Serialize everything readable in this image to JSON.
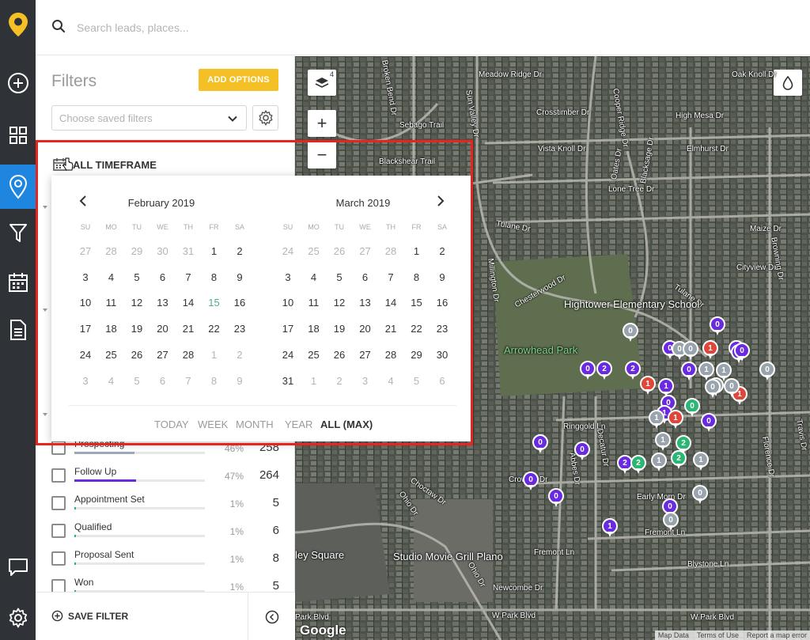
{
  "search": {
    "placeholder": "Search leads, places..."
  },
  "rail": {
    "items": [
      {
        "icon": "app-logo-icon"
      },
      {
        "icon": "plus-circle-icon"
      },
      {
        "icon": "grid-icon"
      },
      {
        "icon": "map-pin-icon",
        "active": true
      },
      {
        "icon": "filter-icon"
      },
      {
        "icon": "calendar-icon"
      },
      {
        "icon": "document-icon"
      },
      {
        "icon": "chat-icon"
      },
      {
        "icon": "settings-icon"
      }
    ],
    "colors": {
      "bg": "#2f3236",
      "active": "#1f86e0",
      "logo": "#f4c025"
    }
  },
  "filters": {
    "title": "Filters",
    "add_options": "ADD OPTIONS",
    "saved_filters_placeholder": "Choose saved filters",
    "timeframe_label": "ALL TIMEFRAME",
    "save_filter": "SAVE FILTER"
  },
  "statuses": [
    {
      "name": "Prospecting",
      "percent": "46%",
      "count": "258",
      "fill": 0.46,
      "color": "#9aa9b8"
    },
    {
      "name": "Follow Up",
      "percent": "47%",
      "count": "264",
      "fill": 0.47,
      "color": "#6a2be0"
    },
    {
      "name": "Appointment Set",
      "percent": "1%",
      "count": "5",
      "fill": 0.01,
      "color": "#2bb673"
    },
    {
      "name": "Qualified",
      "percent": "1%",
      "count": "6",
      "fill": 0.01,
      "color": "#2bb673"
    },
    {
      "name": "Proposal Sent",
      "percent": "1%",
      "count": "8",
      "fill": 0.01,
      "color": "#2bb673"
    },
    {
      "name": "Won",
      "percent": "1%",
      "count": "5",
      "fill": 0.01,
      "color": "#2bb673"
    }
  ],
  "datepicker": {
    "left_month": "February 2019",
    "right_month": "March 2019",
    "weekdays": [
      "SU",
      "MO",
      "TU",
      "WE",
      "TH",
      "FR",
      "SA"
    ],
    "feb_weeks": [
      [
        "27",
        "28",
        "29",
        "30",
        "31",
        "1",
        "2"
      ],
      [
        "3",
        "4",
        "5",
        "6",
        "7",
        "8",
        "9"
      ],
      [
        "10",
        "11",
        "12",
        "13",
        "14",
        "15",
        "16"
      ],
      [
        "17",
        "18",
        "19",
        "20",
        "21",
        "22",
        "23"
      ],
      [
        "24",
        "25",
        "26",
        "27",
        "28",
        "1",
        "2"
      ],
      [
        "3",
        "4",
        "5",
        "6",
        "7",
        "8",
        "9"
      ]
    ],
    "mar_weeks": [
      [
        "24",
        "25",
        "26",
        "27",
        "28",
        "1",
        "2"
      ],
      [
        "3",
        "4",
        "5",
        "6",
        "7",
        "8",
        "9"
      ],
      [
        "10",
        "11",
        "12",
        "13",
        "14",
        "15",
        "16"
      ],
      [
        "17",
        "18",
        "19",
        "20",
        "21",
        "22",
        "23"
      ],
      [
        "24",
        "25",
        "26",
        "27",
        "28",
        "29",
        "30"
      ],
      [
        "31",
        "1",
        "2",
        "3",
        "4",
        "5",
        "6"
      ]
    ],
    "ranges": [
      "TODAY",
      "WEEK",
      "MONTH",
      "YEAR",
      "ALL (MAX)"
    ],
    "active_range": "ALL (MAX)",
    "today_color": "#4caf8f"
  },
  "map": {
    "layers_badge": "4",
    "zoom_in": "+",
    "zoom_out": "−",
    "streets": [
      "Meadow Ridge Dr",
      "Oak Knoll Dr",
      "Cooper Ridge Dr",
      "Crosstimber Dr",
      "High Mesa Dr",
      "Sebago Trail",
      "Vista Knoll Dr",
      "Elmhurst Dr",
      "Blackshear Trail",
      "Lone Tree Dr",
      "Tulane Dr",
      "Maize Dr",
      "Cityview Dr",
      "Chesterwood Dr",
      "Tulane Dr",
      "Ringgold Ln",
      "Crowley Dr",
      "Early Morn Dr",
      "Fremont Ln",
      "Fremont Ln",
      "Blystone Ln",
      "Newcombe Dr",
      "W Park Blvd",
      "W Park Blvd",
      "Choctaw Dr",
      "Ohio Dr",
      "Ohio Dr",
      "Sun Valley Dr",
      "Millington Dr",
      "Abbes Dr",
      "Decatur Dr",
      "Blacksage Dr",
      "Oates Dr",
      "Browning Dr",
      "Florence Dr",
      "Travis Dr",
      "Broken Bend Dr",
      "Park Blvd"
    ],
    "pois": [
      "Hightower Elementary School",
      "Arrowhead Park",
      "Studio Movie Grill Plano",
      "ley Square"
    ],
    "google": "Google",
    "attribution": [
      "Map Data",
      "Terms of Use",
      "Report a map error"
    ],
    "pin_colors": {
      "purple": "#6a2be0",
      "gray": "#9aa4ad",
      "green": "#2bb673",
      "red": "#e0463a"
    },
    "pins": [
      {
        "label": "0",
        "color": "purple"
      },
      {
        "label": "0",
        "color": "gray"
      },
      {
        "label": "0",
        "color": "purple"
      },
      {
        "label": "0",
        "color": "gray"
      },
      {
        "label": "0",
        "color": "gray"
      },
      {
        "label": "1",
        "color": "red"
      },
      {
        "label": "1",
        "color": "purple"
      },
      {
        "label": "0",
        "color": "purple"
      },
      {
        "label": "0",
        "color": "purple"
      },
      {
        "label": "0",
        "color": "purple"
      },
      {
        "label": "2",
        "color": "purple"
      },
      {
        "label": "2",
        "color": "purple"
      },
      {
        "label": "0",
        "color": "purple"
      },
      {
        "label": "1",
        "color": "gray"
      },
      {
        "label": "1",
        "color": "gray"
      },
      {
        "label": "0",
        "color": "gray"
      },
      {
        "label": "1",
        "color": "red"
      },
      {
        "label": "1",
        "color": "purple"
      },
      {
        "label": "1",
        "color": "gray"
      },
      {
        "label": "1",
        "color": "red"
      },
      {
        "label": "0",
        "color": "gray"
      },
      {
        "label": "0",
        "color": "gray"
      },
      {
        "label": "0",
        "color": "purple"
      },
      {
        "label": "1",
        "color": "purple"
      },
      {
        "label": "0",
        "color": "green"
      },
      {
        "label": "1",
        "color": "gray"
      },
      {
        "label": "1",
        "color": "red"
      },
      {
        "label": "0",
        "color": "purple"
      },
      {
        "label": "0",
        "color": "purple"
      },
      {
        "label": "0",
        "color": "purple"
      },
      {
        "label": "1",
        "color": "gray"
      },
      {
        "label": "2",
        "color": "green"
      },
      {
        "label": "2",
        "color": "purple"
      },
      {
        "label": "2",
        "color": "green"
      },
      {
        "label": "1",
        "color": "gray"
      },
      {
        "label": "2",
        "color": "green"
      },
      {
        "label": "1",
        "color": "gray"
      },
      {
        "label": "0",
        "color": "purple"
      },
      {
        "label": "0",
        "color": "gray"
      },
      {
        "label": "0",
        "color": "purple"
      },
      {
        "label": "0",
        "color": "purple"
      },
      {
        "label": "1",
        "color": "purple"
      },
      {
        "label": "0",
        "color": "gray"
      }
    ]
  }
}
